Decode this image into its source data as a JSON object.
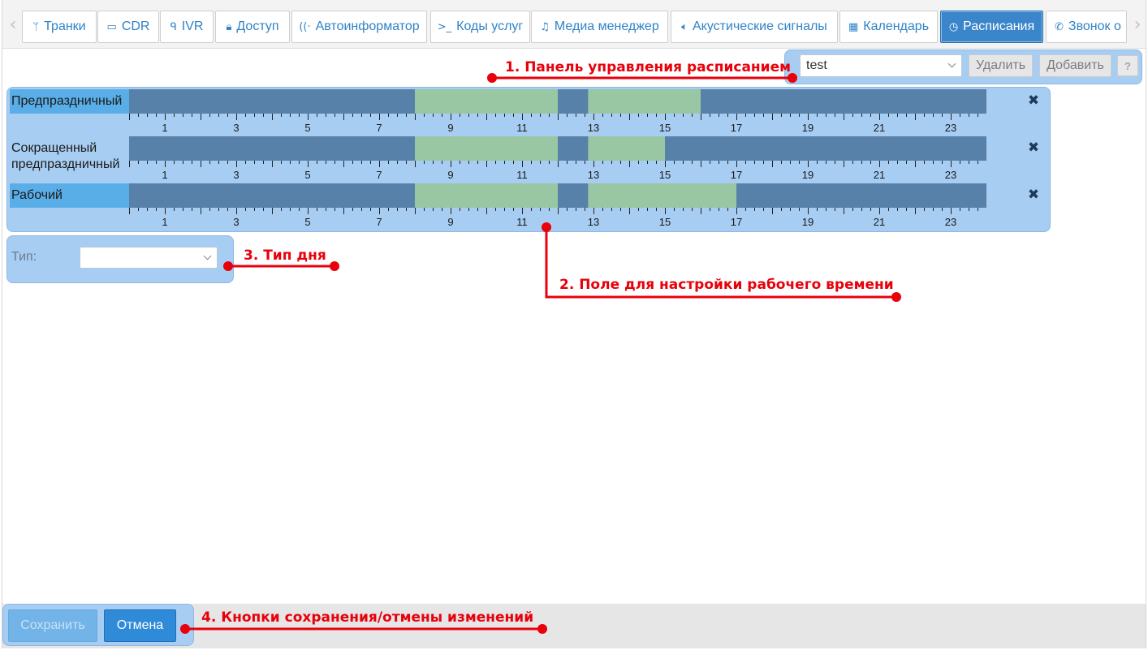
{
  "tabs": [
    {
      "label": "Транки",
      "icon": "branch-icon",
      "glyph": "ᛘ"
    },
    {
      "label": "CDR",
      "icon": "credit-card-icon",
      "glyph": "▭"
    },
    {
      "label": "IVR",
      "icon": "chat-icon",
      "glyph": "ᑫ"
    },
    {
      "label": "Доступ",
      "icon": "lock-icon",
      "glyph": "🔒︎"
    },
    {
      "label": "Автоинформатор",
      "icon": "broadcast-icon",
      "glyph": "((·"
    },
    {
      "label": "Коды услуг",
      "icon": "terminal-icon",
      "glyph": ">_"
    },
    {
      "label": "Медиа менеджер",
      "icon": "music-icon",
      "glyph": "♫"
    },
    {
      "label": "Акустические сигналы",
      "icon": "volume-icon",
      "glyph": "🔈︎"
    },
    {
      "label": "Календарь",
      "icon": "calendar-icon",
      "glyph": "▦"
    },
    {
      "label": "Расписания",
      "icon": "clock-icon",
      "glyph": "◷"
    },
    {
      "label": "Звонок о",
      "icon": "phone-icon",
      "glyph": "✆"
    }
  ],
  "active_tab": "Расписания",
  "schedule_panel": {
    "selected_schedule": "test",
    "delete_label": "Удалить",
    "add_label": "Добавить",
    "help_label": "?"
  },
  "day_rows": [
    {
      "line1": "Предпраздничный",
      "line2": "",
      "work_periods": [
        [
          8,
          12
        ],
        [
          12.85,
          16
        ]
      ]
    },
    {
      "line1": "Сокращенный",
      "line2": "предпраздничный",
      "work_periods": [
        [
          8,
          12
        ],
        [
          12.85,
          15
        ]
      ]
    },
    {
      "line1": "Рабочий",
      "line2": "",
      "work_periods": [
        [
          8,
          12
        ],
        [
          12.85,
          17
        ]
      ]
    }
  ],
  "timeline": {
    "hours": 24,
    "tick_labels": [
      "1",
      "3",
      "5",
      "7",
      "9",
      "11",
      "13",
      "15",
      "17",
      "19",
      "21",
      "23"
    ],
    "tick_label_hours": [
      1,
      3,
      5,
      7,
      9,
      11,
      13,
      15,
      17,
      19,
      21,
      23
    ],
    "colors": {
      "off": "#5781a8",
      "work": "#99c7a3",
      "label_highlight": "#5aaee8"
    }
  },
  "remove_glyph": "✖",
  "type_panel": {
    "label": "Тип:",
    "value": ""
  },
  "footer": {
    "save_label": "Сохранить",
    "cancel_label": "Отмена"
  },
  "annotations": {
    "a1": "1. Панель управления расписанием",
    "a2": "2. Поле для настройки рабочего времени",
    "a3": "3. Тип дня",
    "a4": "4. Кнопки сохранения/отмены изменений"
  },
  "accent_colors": {
    "tab_active": "#3b86cb",
    "tab_text": "#2f83c7",
    "panel": "#a8cdf2",
    "annotation": "#e8000b"
  }
}
